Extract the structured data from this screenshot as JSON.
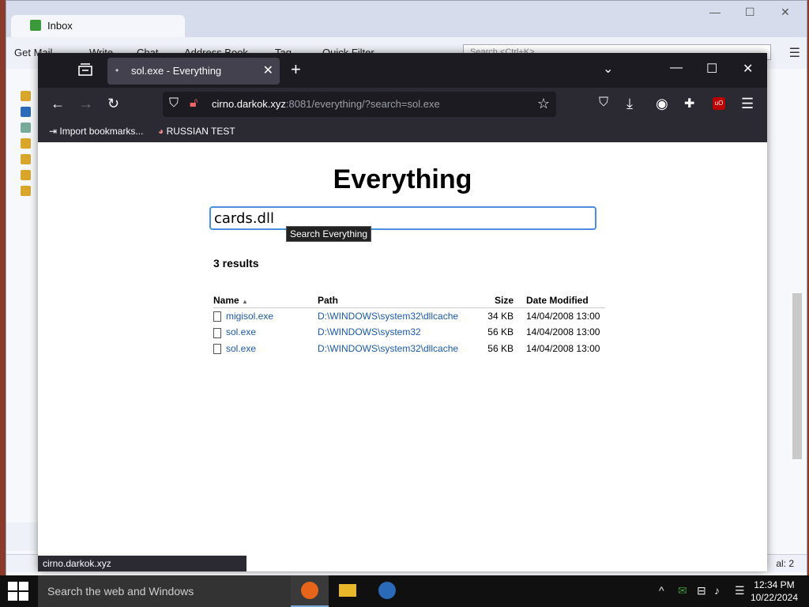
{
  "thunderbird": {
    "tab_label": "Inbox",
    "toolbar": {
      "get_mail": "Get Mail",
      "write": "Write",
      "chat": "Chat",
      "address_book": "Address Book",
      "tag": "Tag",
      "quick_filter": "Quick Filter"
    },
    "search_placeholder": "Search <Ctrl+K>",
    "status_right": "al: 2"
  },
  "firefox": {
    "tab_title": "sol.exe - Everything",
    "url_host": "cirno.darkok.xyz",
    "url_rest": ":8081/everything/?search=sol.exe",
    "bookmarks": [
      {
        "label": "Import bookmarks..."
      },
      {
        "label": "RUSSIAN TEST"
      }
    ],
    "status_url": "cirno.darkok.xyz"
  },
  "page": {
    "heading": "Everything",
    "search_value": "cards.dll",
    "tooltip": "Search Everything",
    "results_count": "3 results",
    "columns": {
      "name": "Name",
      "path": "Path",
      "size": "Size",
      "date": "Date Modified"
    },
    "rows": [
      {
        "name": "migisol.exe",
        "path": "D:\\WINDOWS\\system32\\dllcache",
        "size": "34 KB",
        "date": "14/04/2008 13:00"
      },
      {
        "name": "sol.exe",
        "path": "D:\\WINDOWS\\system32",
        "size": "56 KB",
        "date": "14/04/2008 13:00"
      },
      {
        "name": "sol.exe",
        "path": "D:\\WINDOWS\\system32\\dllcache",
        "size": "56 KB",
        "date": "14/04/2008 13:00"
      }
    ]
  },
  "taskbar": {
    "search_placeholder": "Search the web and Windows",
    "time": "12:34 PM",
    "date": "10/22/2024"
  },
  "colors": {
    "link": "#1a5aa8",
    "search_focus": "#4a90d9"
  }
}
